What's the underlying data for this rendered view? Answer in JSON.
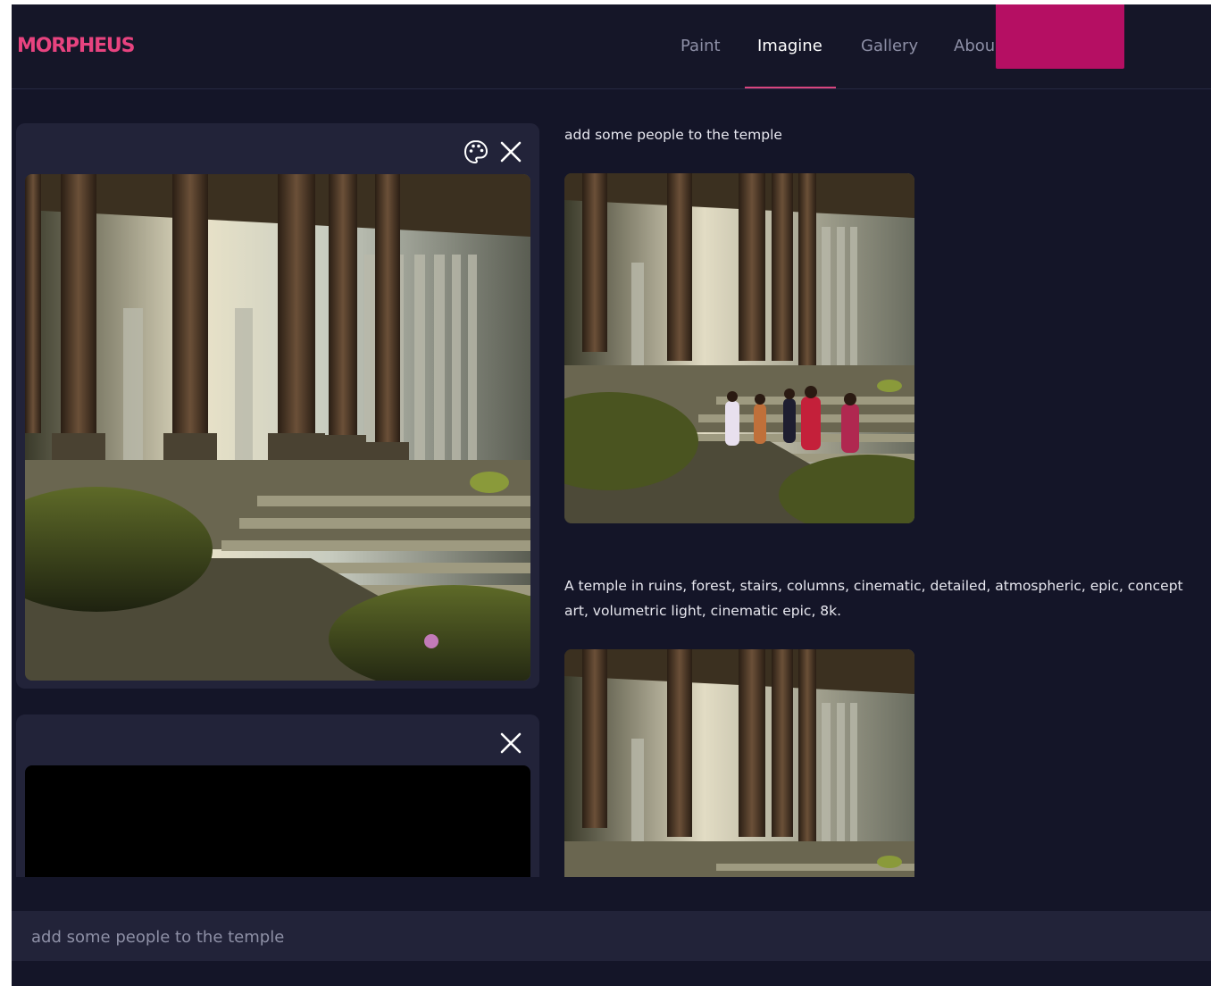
{
  "app": {
    "logo": "MORPHEUS",
    "brand_color": "#e7437f",
    "accent_color": "#b50f63"
  },
  "nav": {
    "items": [
      {
        "label": "Paint",
        "active": false
      },
      {
        "label": "Imagine",
        "active": true
      },
      {
        "label": "Gallery",
        "active": false
      },
      {
        "label": "Abou",
        "active": false
      }
    ]
  },
  "cards": [
    {
      "icons": [
        "palette-icon",
        "close-icon"
      ],
      "image": "temple-ruins-with-columns-and-stairs"
    },
    {
      "icons": [
        "close-icon"
      ],
      "image": "black-empty-canvas"
    }
  ],
  "results": [
    {
      "prompt": "add some people to the temple",
      "image": "temple-with-people-on-stairs"
    },
    {
      "prompt": "A temple in ruins, forest, stairs, columns, cinematic, detailed, atmospheric, epic, concept art, volumetric light, cinematic epic, 8k.",
      "image": "temple-ruins-with-columns"
    }
  ],
  "input": {
    "placeholder": "add some people to the temple"
  }
}
